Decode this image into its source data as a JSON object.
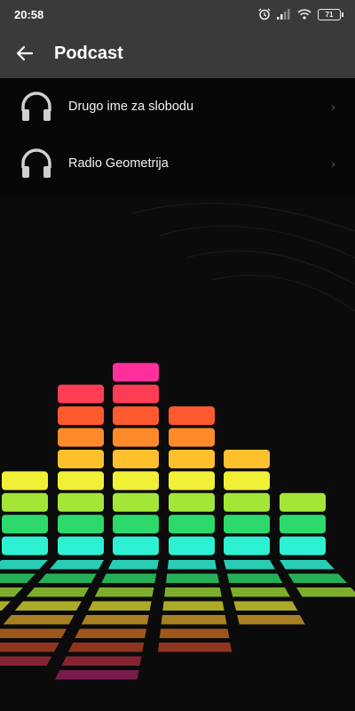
{
  "status_bar": {
    "time": "20:58",
    "battery": "71"
  },
  "app_bar": {
    "title": "Podcast",
    "back_icon": "arrow-left-icon"
  },
  "podcasts": [
    {
      "label": "Drugo ime za slobodu",
      "icon": "headphones-icon"
    },
    {
      "label": "Radio Geometrija",
      "icon": "headphones-icon"
    }
  ],
  "colors": {
    "bar_bg": "#3a3a3a",
    "list_bg": "#070707"
  },
  "background_image": {
    "description": "equalizer",
    "level_colors": [
      "#2ef0d2",
      "#2cd96a",
      "#a4e637",
      "#f0f036",
      "#ffc02e",
      "#ff8a2a",
      "#ff5a2e",
      "#ff3d55",
      "#ff2f9b",
      "#a92cff"
    ],
    "column_levels": [
      4,
      8,
      9,
      7,
      5,
      3
    ]
  }
}
